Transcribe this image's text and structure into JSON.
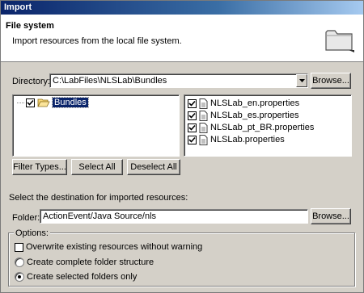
{
  "window": {
    "title": "Import"
  },
  "banner": {
    "title": "File system",
    "description": "Import resources from the local file system."
  },
  "directory": {
    "label": "Directory:",
    "value": "C:\\LabFiles\\NLSLab\\Bundles",
    "browse_label": "Browse..."
  },
  "tree": {
    "items": [
      {
        "label": "Bundles",
        "checked": true,
        "selected": true
      }
    ]
  },
  "files": {
    "items": [
      {
        "label": "NLSLab_en.properties",
        "checked": true
      },
      {
        "label": "NLSLab_es.properties",
        "checked": true
      },
      {
        "label": "NLSLab_pt_BR.properties",
        "checked": true
      },
      {
        "label": "NLSLab.properties",
        "checked": true
      }
    ]
  },
  "buttons": {
    "filter_types": "Filter Types...",
    "select_all": "Select All",
    "deselect_all": "Deselect All"
  },
  "destination": {
    "prompt": "Select the destination for imported resources:",
    "folder_label": "Folder:",
    "folder_value": "ActionEvent/Java Source/nls",
    "browse_label": "Browse..."
  },
  "options": {
    "title": "Options:",
    "overwrite_label": "Overwrite existing resources without warning",
    "overwrite_checked": false,
    "create_complete_label": "Create complete folder structure",
    "create_selected_label": "Create selected folders only",
    "selected_option": "create_selected"
  }
}
